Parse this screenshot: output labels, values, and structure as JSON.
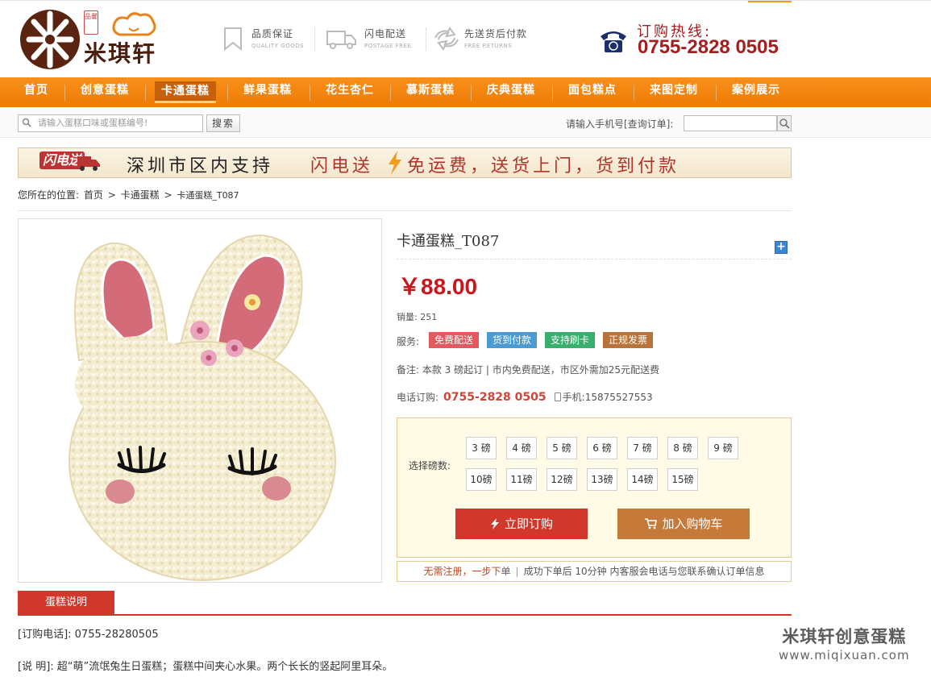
{
  "brand": {
    "name": "米琪轩",
    "seal": "品馨"
  },
  "features": [
    {
      "title": "品质保证",
      "sub": "QUALITY GOODS",
      "icon": "bookmark-icon"
    },
    {
      "title": "闪电配送",
      "sub": "POSTAGE FREE",
      "icon": "truck-icon"
    },
    {
      "title": "先送货后付款",
      "sub": "FREE RETURNS",
      "icon": "exchange-icon"
    }
  ],
  "hotline": {
    "label": "订购热线:",
    "number": "0755-2828 0505"
  },
  "nav": {
    "items": [
      "首页",
      "创意蛋糕",
      "卡通蛋糕",
      "鲜果蛋糕",
      "花生杏仁",
      "慕斯蛋糕",
      "庆典蛋糕",
      "面包糕点",
      "来图定制",
      "案例展示"
    ],
    "active": "卡通蛋糕"
  },
  "search": {
    "placeholder": "请输入蛋糕口味或蛋糕编号!",
    "button": "搜索",
    "order_query_label": "请输入手机号[查询订单]:"
  },
  "banner": {
    "logo": "闪电送",
    "text1": "深圳市区内支持",
    "text2": "闪电送",
    "text3": "免运费，送货上门，货到付款"
  },
  "breadcrumb": [
    "您所在的位置:",
    "首页",
    ">",
    "卡通蛋糕",
    ">",
    "卡通蛋糕_T087"
  ],
  "product": {
    "title": "卡通蛋糕_T087",
    "price": "￥88.00",
    "sales": "销量: 251",
    "services_label": "服务:",
    "services": [
      {
        "label": "免费配送",
        "color": "#e35a5e"
      },
      {
        "label": "货到付款",
        "color": "#4a9bd1"
      },
      {
        "label": "支持刷卡",
        "color": "#3aae6d"
      },
      {
        "label": "正规发票",
        "color": "#b8733a"
      }
    ],
    "notes": "备注: 本款 3 磅起订 | 市内免费配送，市区外需加25元配送费",
    "phone_label": "电话订购:",
    "phone": "0755-2828 0505",
    "mobile_label": "手机:",
    "mobile": "15875527553"
  },
  "selector": {
    "label": "选择磅数:",
    "row1": [
      "3 磅",
      "4 磅",
      "5 磅",
      "6 磅",
      "7 磅",
      "8 磅",
      "9 磅"
    ],
    "row2": [
      "10磅",
      "11磅",
      "12磅",
      "13磅",
      "14磅",
      "15磅"
    ],
    "buy_now": "立即订购",
    "add_cart": "加入购物车"
  },
  "tip": {
    "highlight": "无需注册，一步下单",
    "rest": "成功下单后 10分钟 内客服会电话与您联系确认订单信息"
  },
  "description": {
    "tab": "蛋糕说明",
    "phone": "[订购电话]: 0755-28280505",
    "text": "[说 明]: 超“萌”流氓兔生日蛋糕；蛋糕中间夹心水果。两个长长的竖起阿里耳朵。"
  },
  "watermark": {
    "title": "米琪轩创意蛋糕",
    "url": "www.miqixuan.com"
  },
  "colors": {
    "nav": "#f7901a",
    "price": "#c8171d",
    "accent": "#d1382b",
    "hotline": "#a31e1e"
  }
}
